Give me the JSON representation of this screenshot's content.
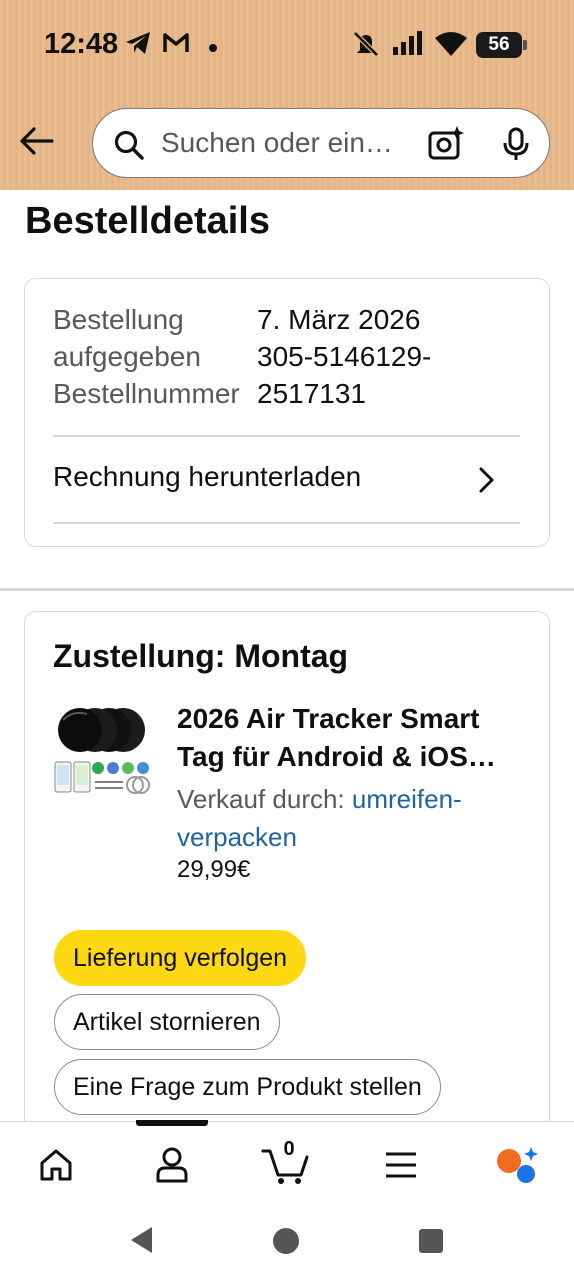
{
  "status_bar": {
    "time": "12:48",
    "battery": "56",
    "icons": [
      "telegram-icon",
      "gmail-icon",
      "dot-icon",
      "mute-icon",
      "signal-icon",
      "wifi-icon",
      "battery-icon"
    ]
  },
  "header": {
    "back_icon": "arrow-left-icon",
    "search_placeholder": "Suchen oder ein…",
    "camera_icon": "camera-lens-icon",
    "mic_icon": "microphone-icon"
  },
  "page": {
    "title": "Bestelldetails"
  },
  "order_info": {
    "placed_label": "Bestellung aufgegeben",
    "placed_label_line1": "Bestellung",
    "placed_label_line2": "aufgegeben",
    "placed_value": "7. März 2026",
    "number_label": "Bestellnummer",
    "number_value": "305-5146129-2517131",
    "number_value_line1": "305-5146129-",
    "number_value_line2": "2517131",
    "invoice_label": "Rechnung herunterladen"
  },
  "delivery": {
    "title": "Zustellung: Montag",
    "product": {
      "title": "2026 Air Tracker Smart Tag für Android & iOS…",
      "title_line1": "2026 Air Tracker Smart",
      "title_line2": "Tag für Android & iOS…",
      "seller_prefix": "Verkauf durch:",
      "seller_name": "umreifen-verpacken",
      "price": "29,99€"
    },
    "buttons": {
      "track": "Lieferung verfolgen",
      "cancel": "Artikel stornieren",
      "question": "Eine Frage zum Produkt stellen"
    }
  },
  "bottom_nav": {
    "items": [
      "home-icon",
      "account-icon",
      "cart-icon",
      "menu-icon",
      "rufus-icon"
    ],
    "cart_count": "0",
    "active_index": 1
  },
  "colors": {
    "header_bg": "#e8b889",
    "primary_button": "#ffd814",
    "link": "#2162a1",
    "secondary_text": "#565959"
  }
}
